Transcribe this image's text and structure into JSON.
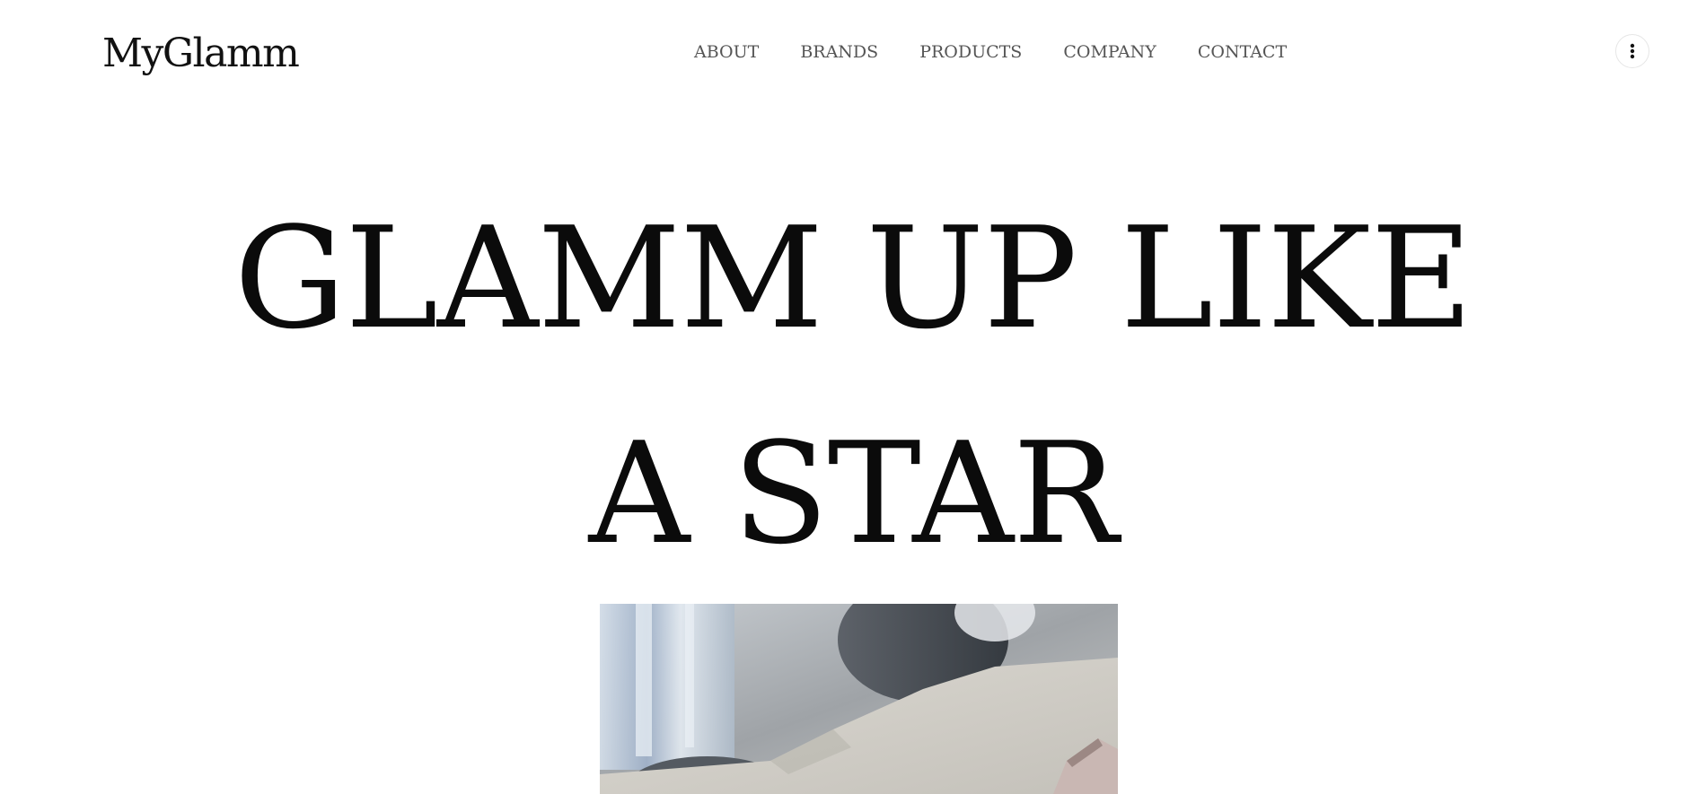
{
  "brand": {
    "logo_text": "MyGlamm"
  },
  "nav": {
    "items": [
      {
        "label": "ABOUT"
      },
      {
        "label": "BRANDS"
      },
      {
        "label": "PRODUCTS"
      },
      {
        "label": "COMPANY"
      },
      {
        "label": "CONTACT"
      }
    ]
  },
  "header": {
    "menu_icon": "more-vertical-icon"
  },
  "hero": {
    "title_line_1": "GLAMM UP LIKE",
    "title_line_2": "A STAR"
  },
  "colors": {
    "background": "#ffffff",
    "text": "#111111",
    "nav_text": "#555555"
  }
}
